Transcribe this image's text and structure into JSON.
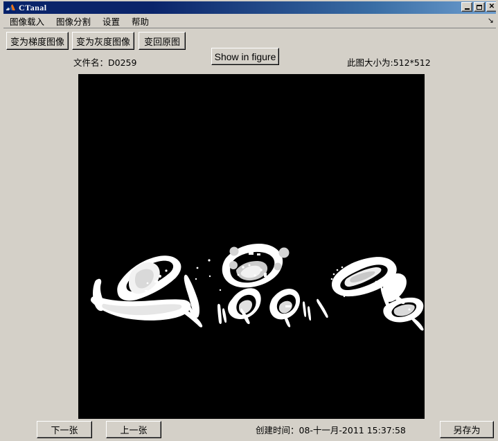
{
  "window": {
    "title": "CTanal",
    "icon": "matlab-logo-icon",
    "buttons": {
      "minimize": "_",
      "maximize": "□",
      "close": "✕"
    }
  },
  "menu": {
    "items": [
      {
        "label": "图像载入",
        "name": "menu-image-load"
      },
      {
        "label": "图像分割",
        "name": "menu-image-segment"
      },
      {
        "label": "设置",
        "name": "menu-settings"
      },
      {
        "label": "帮助",
        "name": "menu-help"
      }
    ],
    "corner_icon": "↘"
  },
  "toolbar": {
    "gradient_button": "变为梯度图像",
    "grayscale_button": "变为灰度图像",
    "restore_button": "变回原图",
    "show_in_figure_button": "Show in figure"
  },
  "info": {
    "filename_label": "文件名：D0259",
    "size_label": "此图大小为:512*512",
    "created_label": "创建时间：08-十一月-2011 15:37:58"
  },
  "footer": {
    "next_button": "下一张",
    "prev_button": "上一张",
    "save_as_button": "另存为"
  },
  "image": {
    "background_color": "#000000",
    "foreground_color": "#ffffff",
    "description": "segmented-ct-slice"
  },
  "colors": {
    "window_face": "#d4d0c8",
    "title_active_left": "#0a246a",
    "title_active_right": "#6f9fd0",
    "text": "#000000"
  }
}
